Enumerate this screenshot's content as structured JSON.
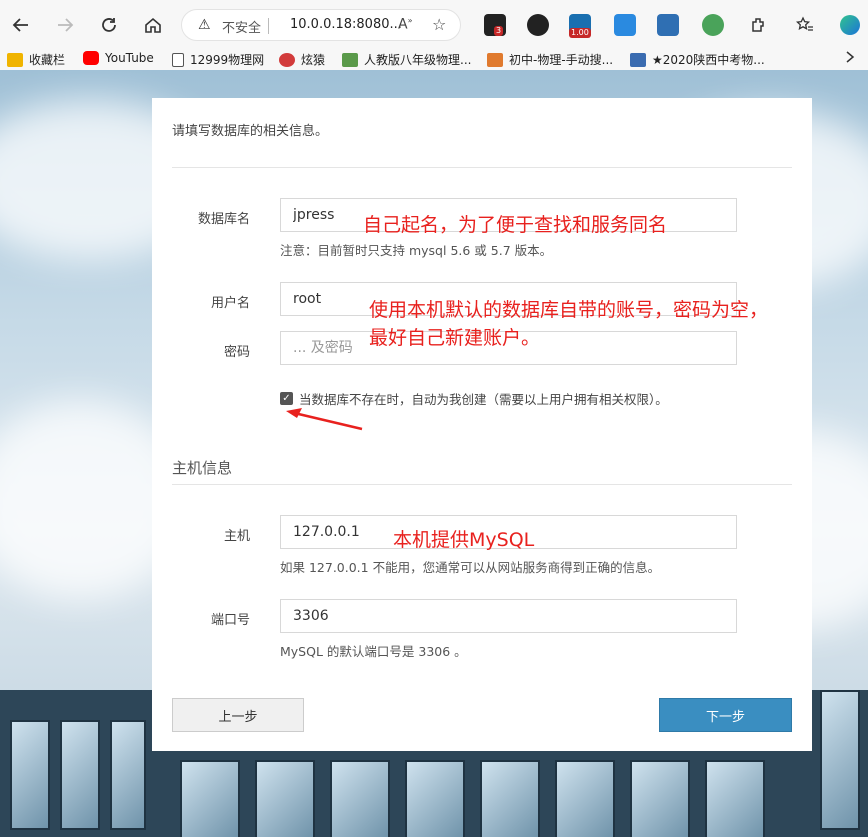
{
  "browser": {
    "address_warning": "不安全",
    "address_url": "10.0.0.18:8080...",
    "ext_badge_red": "3",
    "ext_badge_speed": "1.00"
  },
  "bookmarks": [
    {
      "label": "收藏栏",
      "icon": "folder-icon",
      "color": "#f0b400"
    },
    {
      "label": "YouTube",
      "icon": "youtube-icon",
      "color": "#ff0000"
    },
    {
      "label": "12999物理网",
      "icon": "page-icon",
      "color": "#ffffff"
    },
    {
      "label": "炫猿",
      "icon": "xuanyuan-icon",
      "color": "#d23b3b"
    },
    {
      "label": "人教版八年级物理...",
      "icon": "book-icon",
      "color": "#5a9a4a"
    },
    {
      "label": "初中-物理-手动搜...",
      "icon": "fox-icon",
      "color": "#e07a2e"
    },
    {
      "label": "★2020陕西中考物...",
      "icon": "kao-icon",
      "color": "#3a6bb0"
    }
  ],
  "form": {
    "intro": "请填写数据库的相关信息。",
    "db_name_label": "数据库名",
    "db_name_value": "jpress",
    "db_hint": "注意：目前暂时只支持 mysql 5.6 或 5.7 版本。",
    "user_label": "用户名",
    "user_value": "root",
    "password_label": "密码",
    "password_placeholder": "... 及密码",
    "auto_create_label": "当数据库不存在时，自动为我创建（需要以上用户拥有相关权限）。",
    "host_section": "主机信息",
    "host_label": "主机",
    "host_value": "127.0.0.1",
    "host_hint": "如果 127.0.0.1 不能用，您通常可以从网站服务商得到正确的信息。",
    "port_label": "端口号",
    "port_value": "3306",
    "port_hint": "MySQL 的默认端口号是 3306 。",
    "prev_button": "上一步",
    "next_button": "下一步"
  },
  "annotations": {
    "db_note": "自己起名，为了便于查找和服务同名",
    "user_note_line1": "使用本机默认的数据库自带的账号，密码为空，",
    "user_note_line2": "最好自己新建账户。",
    "host_note": "本机提供MySQL"
  },
  "colors": {
    "annotation": "#e8211e",
    "primary_button": "#3a8ec1"
  }
}
